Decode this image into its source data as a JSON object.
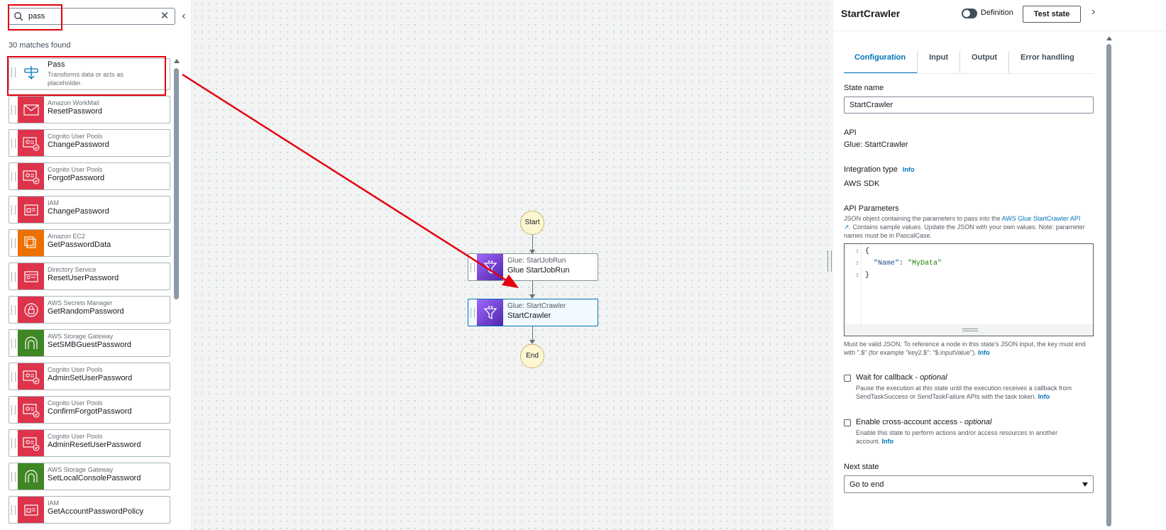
{
  "search": {
    "value": "pass",
    "matches": "30 matches found"
  },
  "states_list": [
    {
      "service": "Transforms data or acts as placeholder.",
      "action": "Pass",
      "color": "#ffffff",
      "icon": "pass-icon"
    },
    {
      "service": "Amazon WorkMail",
      "action": "ResetPassword",
      "color": "#dd344c",
      "icon": "mail-icon"
    },
    {
      "service": "Cognito User Pools",
      "action": "ChangePassword",
      "color": "#dd344c",
      "icon": "cognito-icon"
    },
    {
      "service": "Cognito User Pools",
      "action": "ForgotPassword",
      "color": "#dd344c",
      "icon": "cognito-icon"
    },
    {
      "service": "IAM",
      "action": "ChangePassword",
      "color": "#dd344c",
      "icon": "iam-icon"
    },
    {
      "service": "Amazon EC2",
      "action": "GetPasswordData",
      "color": "#ed7100",
      "icon": "ec2-icon"
    },
    {
      "service": "Directory Service",
      "action": "ResetUserPassword",
      "color": "#dd344c",
      "icon": "directory-icon"
    },
    {
      "service": "AWS Secrets Manager",
      "action": "GetRandomPassword",
      "color": "#dd344c",
      "icon": "secrets-icon"
    },
    {
      "service": "AWS Storage Gateway",
      "action": "SetSMBGuestPassword",
      "color": "#3f8624",
      "icon": "storage-gateway-icon"
    },
    {
      "service": "Cognito User Pools",
      "action": "AdminSetUserPassword",
      "color": "#dd344c",
      "icon": "cognito-icon"
    },
    {
      "service": "Cognito User Pools",
      "action": "ConfirmForgotPassword",
      "color": "#dd344c",
      "icon": "cognito-icon"
    },
    {
      "service": "Cognito User Pools",
      "action": "AdminResetUserPassword",
      "color": "#dd344c",
      "icon": "cognito-icon"
    },
    {
      "service": "AWS Storage Gateway",
      "action": "SetLocalConsolePassword",
      "color": "#3f8624",
      "icon": "storage-gateway-icon"
    },
    {
      "service": "IAM",
      "action": "GetAccountPasswordPolicy",
      "color": "#dd344c",
      "icon": "iam-icon"
    }
  ],
  "canvas": {
    "start": "Start",
    "end": "End",
    "state1": {
      "service": "Glue: StartJobRun",
      "action": "Glue StartJobRun"
    },
    "state2": {
      "service": "Glue: StartCrawler",
      "action": "StartCrawler"
    }
  },
  "panel": {
    "title": "StartCrawler",
    "definition_label": "Definition",
    "test_button": "Test state",
    "tabs": [
      "Configuration",
      "Input",
      "Output",
      "Error handling"
    ],
    "state_name_label": "State name",
    "state_name_value": "StartCrawler",
    "api_label": "API",
    "api_value": "Glue: StartCrawler",
    "integration_label": "Integration type",
    "info": "Info",
    "integration_value": "AWS SDK",
    "api_params_label": "API Parameters",
    "api_params_desc_1": "JSON object containing the parameters to pass into the ",
    "api_params_link": "AWS Glue StartCrawler API",
    "api_params_desc_2": ". Contains sample values. Update the JSON with your own values. Note: parameter names must be in PascalCase.",
    "code_lines": [
      "{",
      "  \"Name\": \"MyData\"",
      "}"
    ],
    "json_hint": "Must be valid JSON. To reference a node in this state's JSON input, the key must end with \".$\" (for example \"key2.$\": \"$.inputValue\").",
    "wait_label": "Wait for callback - ",
    "optional": "optional",
    "wait_desc": "Pause the execution at this state until the execution receives a callback from SendTaskSuccess or SendTaskFailure APIs with the task token.",
    "cross_label": "Enable cross-account access - ",
    "cross_desc": "Enable this state to perform actions and/or access resources in another account.",
    "next_state_label": "Next state",
    "next_state_value": "Go to end"
  },
  "colors": {
    "accent": "#0073bb",
    "highlight": "#e3000f",
    "glue": "#8c4fff"
  }
}
